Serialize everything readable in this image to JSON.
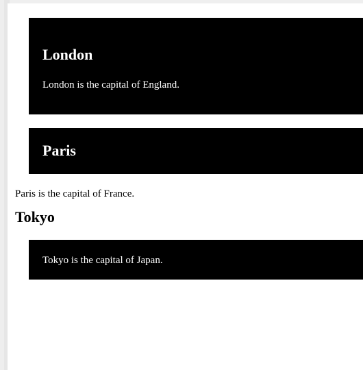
{
  "cities": {
    "london": {
      "heading": "London",
      "text": "London is the capital of England."
    },
    "paris": {
      "heading": "Paris",
      "text": "Paris is the capital of France."
    },
    "tokyo": {
      "heading": "Tokyo",
      "text": "Tokyo is the capital of Japan."
    }
  },
  "colors": {
    "block_background": "#000000",
    "block_text": "#ffffff",
    "page_background": "#ffffff"
  }
}
